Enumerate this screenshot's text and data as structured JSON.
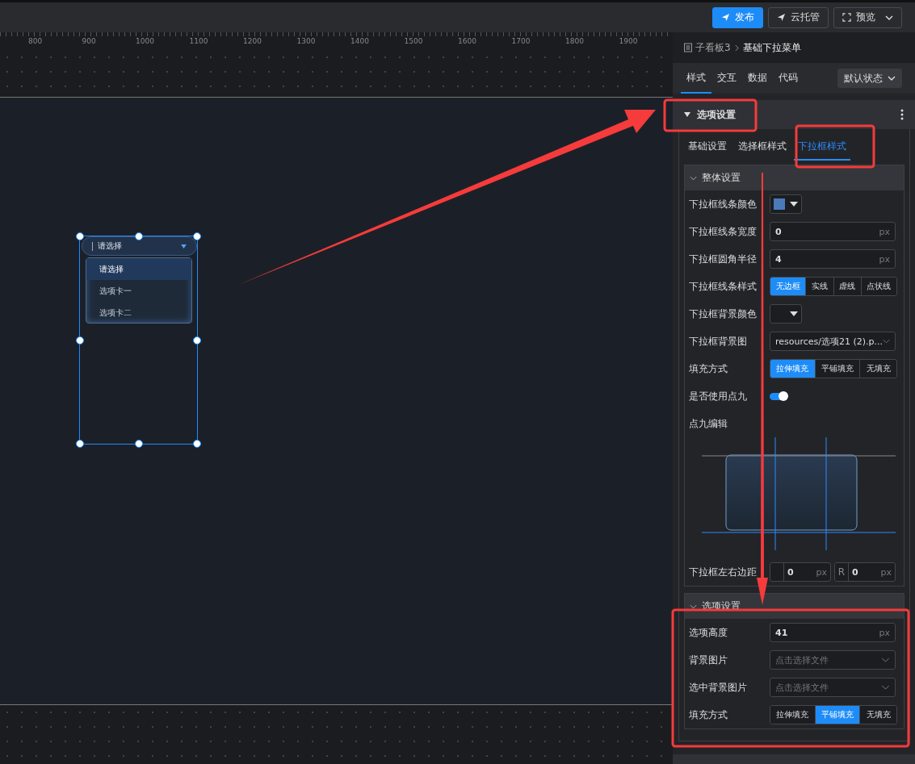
{
  "toolbar": {
    "buttons": [
      {
        "label": "发布",
        "kind": "primary"
      },
      {
        "label": "云托管",
        "kind": "default"
      },
      {
        "label": "预览",
        "kind": "dropdown"
      }
    ]
  },
  "ruler": {
    "ticks": [
      "800",
      "900",
      "1000",
      "1100",
      "1200",
      "1300",
      "1400",
      "1500",
      "1600",
      "1700",
      "1800",
      "1900"
    ]
  },
  "canvas": {
    "widget": {
      "value": "请选择",
      "options": [
        {
          "label": "请选择",
          "selected": true
        },
        {
          "label": "选项卡一",
          "selected": false
        },
        {
          "label": "选项卡二",
          "selected": false
        }
      ]
    }
  },
  "breadcrumb": [
    "子看板3",
    "基础下拉菜单"
  ],
  "tabs": [
    {
      "label": "样式",
      "selected": true
    },
    {
      "label": "交互",
      "selected": false
    },
    {
      "label": "数据",
      "selected": false
    },
    {
      "label": "代码",
      "selected": false
    }
  ],
  "state_select": "默认状态",
  "section": {
    "title": "选项设置",
    "expanded": true
  },
  "subtabs": [
    {
      "label": "基础设置",
      "selected": false
    },
    {
      "label": "选择框样式",
      "selected": false
    },
    {
      "label": "下拉框样式",
      "selected": true
    }
  ],
  "groups": [
    {
      "title": "整体设置",
      "expanded": true,
      "rows": [
        {
          "kind": "color",
          "label": "下拉框线条颜色",
          "color": "#4a7ab8"
        },
        {
          "kind": "number",
          "label": "下拉框线条宽度",
          "value": "0",
          "unit": "px"
        },
        {
          "kind": "number",
          "label": "下拉框圆角半径",
          "value": "4",
          "unit": "px"
        },
        {
          "kind": "segmented",
          "label": "下拉框线条样式",
          "options": [
            {
              "label": "无边框",
              "selected": true
            },
            {
              "label": "实线",
              "selected": false
            },
            {
              "label": "虚线",
              "selected": false
            },
            {
              "label": "点状线",
              "selected": false
            }
          ]
        },
        {
          "kind": "color",
          "label": "下拉框背景颜色"
        },
        {
          "kind": "select",
          "label": "下拉框背景图",
          "value": "resources/选项21 (2).p..."
        },
        {
          "kind": "segmented",
          "label": "填充方式",
          "options": [
            {
              "label": "拉伸填充",
              "selected": true
            },
            {
              "label": "平铺填充",
              "selected": false
            },
            {
              "label": "无填充",
              "selected": false
            }
          ]
        },
        {
          "kind": "toggle",
          "label": "是否使用点九",
          "on": true
        },
        {
          "kind": "ninepatch",
          "label": "点九编辑"
        },
        {
          "kind": "pair",
          "label": "下拉框左右边距",
          "fields": [
            {
              "value": "0",
              "unit": "px"
            },
            {
              "prefix": "R",
              "value": "0",
              "unit": "px"
            }
          ]
        }
      ]
    },
    {
      "title": "选项设置",
      "expanded": true,
      "rows": [
        {
          "kind": "number",
          "label": "选项高度",
          "value": "41",
          "unit": "px"
        },
        {
          "kind": "select",
          "label": "背景图片",
          "placeholder": "点击选择文件"
        },
        {
          "kind": "select",
          "label": "选中背景图片",
          "placeholder": "点击选择文件"
        },
        {
          "kind": "segmented",
          "label": "填充方式",
          "options": [
            {
              "label": "拉伸填充",
              "selected": false
            },
            {
              "label": "平铺填充",
              "selected": true
            },
            {
              "label": "无填充",
              "selected": false
            }
          ]
        }
      ]
    }
  ]
}
